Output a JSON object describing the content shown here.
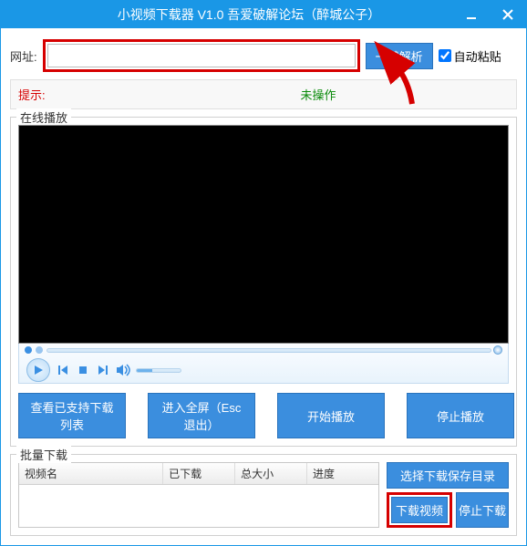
{
  "window": {
    "title": "小视频下载器 V1.0  吾爱破解论坛（醉城公子）"
  },
  "url_row": {
    "label": "网址:",
    "value": "",
    "parse_button": "一键解析",
    "auto_paste": "自动粘贴",
    "auto_paste_checked": true
  },
  "tip": {
    "label": "提示:",
    "status": "未操作"
  },
  "online_play": {
    "title": "在线播放"
  },
  "action_buttons": {
    "view_list": "查看已支持下载列表",
    "fullscreen": "进入全屏（Esc退出）",
    "start_play": "开始播放",
    "stop_play": "停止播放"
  },
  "batch": {
    "title": "批量下载",
    "columns": {
      "name": "视频名",
      "downloaded": "已下载",
      "total_size": "总大小",
      "progress": "进度"
    },
    "side": {
      "choose_dir": "选择下载保存目录",
      "download_video": "下载视频",
      "stop_download": "停止下载"
    }
  }
}
